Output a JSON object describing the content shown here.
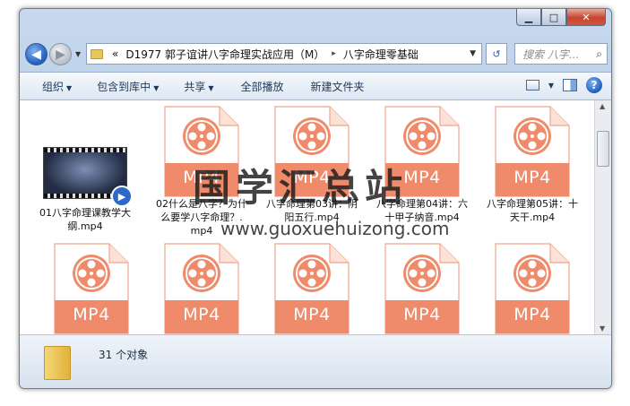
{
  "window": {
    "controls": {
      "minimize": "▁",
      "maximize": "□",
      "close": "✕"
    }
  },
  "nav": {
    "back_icon": "arrow-left",
    "forward_icon": "arrow-right",
    "address_prefix": "«",
    "address_segments": [
      "D1977 郭子谊讲八字命理实战应用（M）",
      "八字命理零基础"
    ],
    "address_separator": "▸",
    "search_placeholder": "搜索 八字...",
    "refresh_icon": "↺"
  },
  "toolbar": {
    "organize": "组织",
    "include_library": "包含到库中",
    "share": "共享",
    "play_all": "全部播放",
    "new_folder": "新建文件夹"
  },
  "files": [
    {
      "name": "01八字命理课教学大纲.mp4",
      "type": "video-thumb"
    },
    {
      "name": "02什么是八字？为什么要学八字命理？.mp4",
      "type": "mp4"
    },
    {
      "name": "八字命理第03讲：阴阳五行.mp4",
      "type": "mp4"
    },
    {
      "name": "八字命理第04讲：六十甲子纳音.mp4",
      "type": "mp4"
    },
    {
      "name": "八字命理第05讲：十天干.mp4",
      "type": "mp4"
    },
    {
      "name": "",
      "type": "mp4"
    },
    {
      "name": "",
      "type": "mp4"
    },
    {
      "name": "",
      "type": "mp4"
    },
    {
      "name": "",
      "type": "mp4"
    },
    {
      "name": "",
      "type": "mp4"
    }
  ],
  "mp4_label": "MP4",
  "watermark": {
    "title": "国学汇总站",
    "url": "www.guoxuehuizong.com"
  },
  "status": {
    "count": "31 个对象"
  },
  "colors": {
    "mp4_accent": "#ef8a6a",
    "mp4_light": "#f7b8a2",
    "close_red": "#c6452f"
  }
}
